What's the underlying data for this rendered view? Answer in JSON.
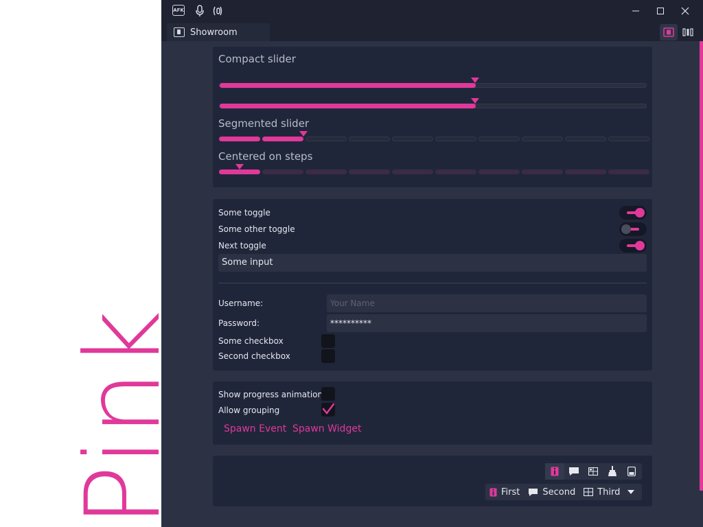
{
  "side_text": "Pink",
  "accent_color": "#e0399a",
  "titlebar": {
    "afk_label": "AFK",
    "icons": [
      "afk-icon",
      "microphone-icon",
      "speaker-icon"
    ],
    "controls": [
      "minimize-icon",
      "maximize-icon",
      "close-icon"
    ]
  },
  "tab": {
    "title": "Showroom"
  },
  "sliders": {
    "compact_heading": "Compact slider",
    "compact_1_value": 0.6,
    "compact_2_value": 0.6,
    "segmented_heading": "Segmented slider",
    "segmented_steps": 10,
    "segmented_value": 2,
    "centered_heading": "Centered on steps",
    "centered_value": 1
  },
  "toggles": [
    {
      "label": "Some toggle",
      "on": true
    },
    {
      "label": "Some other toggle",
      "on": false
    },
    {
      "label": "Next toggle",
      "on": true
    }
  ],
  "some_input": "Some input",
  "form": {
    "username_label": "Username:",
    "username_placeholder": "Your Name",
    "password_label": "Password:",
    "password_value": "**********",
    "checkbox1_label": "Some checkbox",
    "checkbox2_label": "Second checkbox"
  },
  "options": {
    "progress_label": "Show progress animation",
    "progress_checked": false,
    "grouping_label": "Allow grouping",
    "grouping_checked": true,
    "spawn_event": "Spawn Event",
    "spawn_widget": "Spawn Widget"
  },
  "combo": {
    "first": "First",
    "second": "Second",
    "third": "Third"
  }
}
